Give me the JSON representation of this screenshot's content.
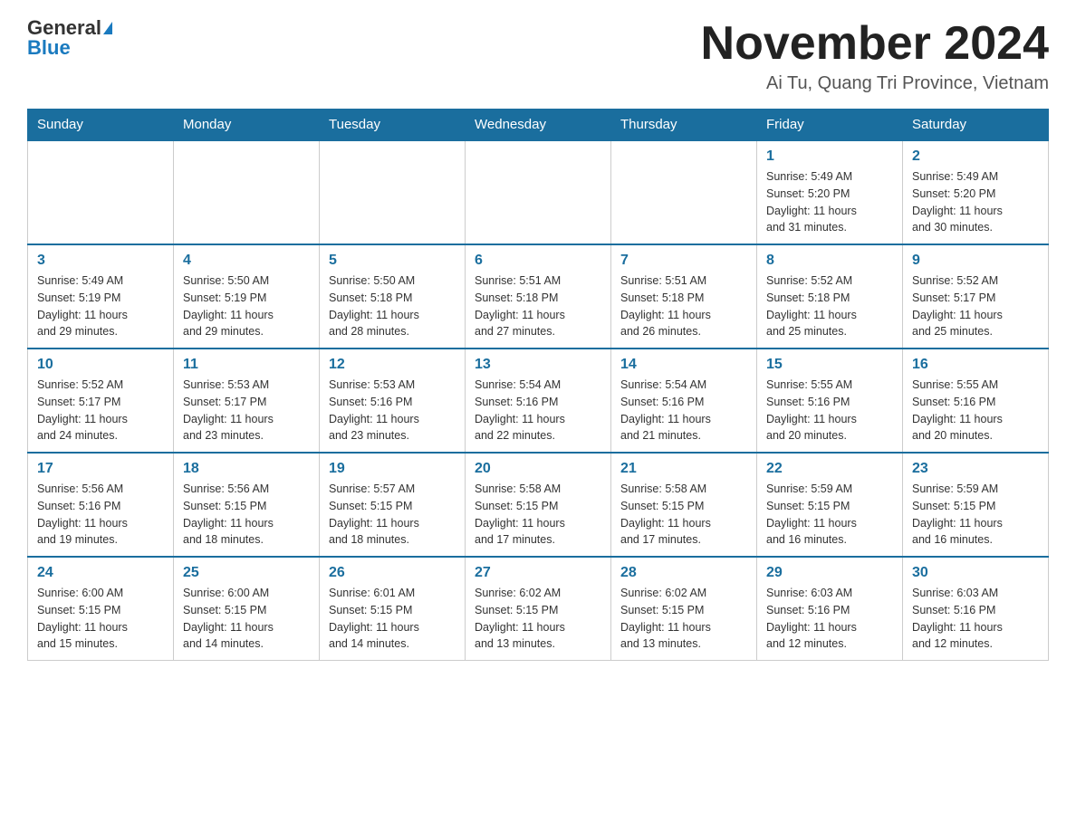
{
  "header": {
    "logo_general": "General",
    "logo_blue": "Blue",
    "month_year": "November 2024",
    "location": "Ai Tu, Quang Tri Province, Vietnam"
  },
  "days_of_week": [
    "Sunday",
    "Monday",
    "Tuesday",
    "Wednesday",
    "Thursday",
    "Friday",
    "Saturday"
  ],
  "weeks": [
    [
      {
        "day": "",
        "info": ""
      },
      {
        "day": "",
        "info": ""
      },
      {
        "day": "",
        "info": ""
      },
      {
        "day": "",
        "info": ""
      },
      {
        "day": "",
        "info": ""
      },
      {
        "day": "1",
        "info": "Sunrise: 5:49 AM\nSunset: 5:20 PM\nDaylight: 11 hours\nand 31 minutes."
      },
      {
        "day": "2",
        "info": "Sunrise: 5:49 AM\nSunset: 5:20 PM\nDaylight: 11 hours\nand 30 minutes."
      }
    ],
    [
      {
        "day": "3",
        "info": "Sunrise: 5:49 AM\nSunset: 5:19 PM\nDaylight: 11 hours\nand 29 minutes."
      },
      {
        "day": "4",
        "info": "Sunrise: 5:50 AM\nSunset: 5:19 PM\nDaylight: 11 hours\nand 29 minutes."
      },
      {
        "day": "5",
        "info": "Sunrise: 5:50 AM\nSunset: 5:18 PM\nDaylight: 11 hours\nand 28 minutes."
      },
      {
        "day": "6",
        "info": "Sunrise: 5:51 AM\nSunset: 5:18 PM\nDaylight: 11 hours\nand 27 minutes."
      },
      {
        "day": "7",
        "info": "Sunrise: 5:51 AM\nSunset: 5:18 PM\nDaylight: 11 hours\nand 26 minutes."
      },
      {
        "day": "8",
        "info": "Sunrise: 5:52 AM\nSunset: 5:18 PM\nDaylight: 11 hours\nand 25 minutes."
      },
      {
        "day": "9",
        "info": "Sunrise: 5:52 AM\nSunset: 5:17 PM\nDaylight: 11 hours\nand 25 minutes."
      }
    ],
    [
      {
        "day": "10",
        "info": "Sunrise: 5:52 AM\nSunset: 5:17 PM\nDaylight: 11 hours\nand 24 minutes."
      },
      {
        "day": "11",
        "info": "Sunrise: 5:53 AM\nSunset: 5:17 PM\nDaylight: 11 hours\nand 23 minutes."
      },
      {
        "day": "12",
        "info": "Sunrise: 5:53 AM\nSunset: 5:16 PM\nDaylight: 11 hours\nand 23 minutes."
      },
      {
        "day": "13",
        "info": "Sunrise: 5:54 AM\nSunset: 5:16 PM\nDaylight: 11 hours\nand 22 minutes."
      },
      {
        "day": "14",
        "info": "Sunrise: 5:54 AM\nSunset: 5:16 PM\nDaylight: 11 hours\nand 21 minutes."
      },
      {
        "day": "15",
        "info": "Sunrise: 5:55 AM\nSunset: 5:16 PM\nDaylight: 11 hours\nand 20 minutes."
      },
      {
        "day": "16",
        "info": "Sunrise: 5:55 AM\nSunset: 5:16 PM\nDaylight: 11 hours\nand 20 minutes."
      }
    ],
    [
      {
        "day": "17",
        "info": "Sunrise: 5:56 AM\nSunset: 5:16 PM\nDaylight: 11 hours\nand 19 minutes."
      },
      {
        "day": "18",
        "info": "Sunrise: 5:56 AM\nSunset: 5:15 PM\nDaylight: 11 hours\nand 18 minutes."
      },
      {
        "day": "19",
        "info": "Sunrise: 5:57 AM\nSunset: 5:15 PM\nDaylight: 11 hours\nand 18 minutes."
      },
      {
        "day": "20",
        "info": "Sunrise: 5:58 AM\nSunset: 5:15 PM\nDaylight: 11 hours\nand 17 minutes."
      },
      {
        "day": "21",
        "info": "Sunrise: 5:58 AM\nSunset: 5:15 PM\nDaylight: 11 hours\nand 17 minutes."
      },
      {
        "day": "22",
        "info": "Sunrise: 5:59 AM\nSunset: 5:15 PM\nDaylight: 11 hours\nand 16 minutes."
      },
      {
        "day": "23",
        "info": "Sunrise: 5:59 AM\nSunset: 5:15 PM\nDaylight: 11 hours\nand 16 minutes."
      }
    ],
    [
      {
        "day": "24",
        "info": "Sunrise: 6:00 AM\nSunset: 5:15 PM\nDaylight: 11 hours\nand 15 minutes."
      },
      {
        "day": "25",
        "info": "Sunrise: 6:00 AM\nSunset: 5:15 PM\nDaylight: 11 hours\nand 14 minutes."
      },
      {
        "day": "26",
        "info": "Sunrise: 6:01 AM\nSunset: 5:15 PM\nDaylight: 11 hours\nand 14 minutes."
      },
      {
        "day": "27",
        "info": "Sunrise: 6:02 AM\nSunset: 5:15 PM\nDaylight: 11 hours\nand 13 minutes."
      },
      {
        "day": "28",
        "info": "Sunrise: 6:02 AM\nSunset: 5:15 PM\nDaylight: 11 hours\nand 13 minutes."
      },
      {
        "day": "29",
        "info": "Sunrise: 6:03 AM\nSunset: 5:16 PM\nDaylight: 11 hours\nand 12 minutes."
      },
      {
        "day": "30",
        "info": "Sunrise: 6:03 AM\nSunset: 5:16 PM\nDaylight: 11 hours\nand 12 minutes."
      }
    ]
  ]
}
